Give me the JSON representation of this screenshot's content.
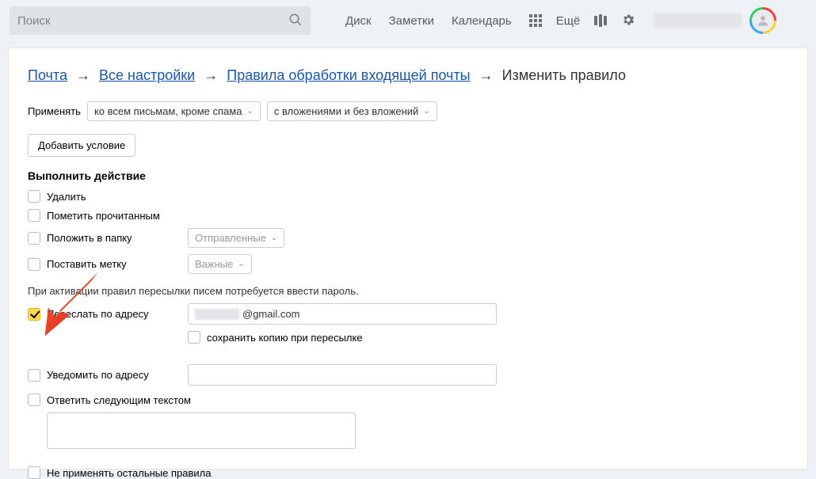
{
  "header": {
    "search_placeholder": "Поиск",
    "nav": {
      "disk": "Диск",
      "notes": "Заметки",
      "calendar": "Календарь",
      "more": "Ещё"
    }
  },
  "breadcrumb": {
    "mail": "Почта",
    "all_settings": "Все настройки",
    "rules": "Правила обработки входящей почты",
    "current": "Изменить правило"
  },
  "apply": {
    "label": "Применять",
    "to_messages": "ко всем письмам, кроме спама",
    "attachments": "с вложениями и без вложений"
  },
  "add_condition": "Добавить условие",
  "actions_title": "Выполнить действие",
  "actions": {
    "delete": "Удалить",
    "mark_read": "Пометить прочитанным",
    "move_to_folder": "Положить в папку",
    "folder_value": "Отправленные",
    "set_label": "Поставить метку",
    "label_value": "Важные"
  },
  "forward": {
    "note": "При активации правил пересылки писем потребуется ввести пароль.",
    "forward_label": "Переслать по адресу",
    "email_suffix": "@gmail.com",
    "save_copy": "сохранить копию при пересылке",
    "notify_label": "Уведомить по адресу",
    "reply_label": "Ответить следующим текстом"
  },
  "skip_rest": "Не применять остальные правила"
}
